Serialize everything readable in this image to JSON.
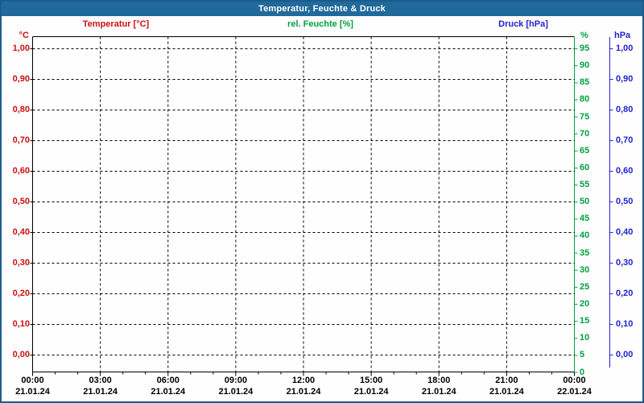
{
  "window": {
    "title": "Temperatur, Feuchte & Druck"
  },
  "colors": {
    "titlebar_bg": "#20699B",
    "frame_border": "#1B5C8D",
    "temperature": "#CC1111",
    "humidity": "#00A040",
    "pressure": "#2222CC",
    "grid": "#000000",
    "background": "#FEFEFE"
  },
  "legend": {
    "temperature": "Temperatur [°C]",
    "humidity": "rel. Feuchte [%]",
    "pressure": "Druck [hPa]"
  },
  "axes": {
    "left": {
      "unit": "°C",
      "color": "#CC1111",
      "ticks": [
        "1,00",
        "0,90",
        "0,80",
        "0,70",
        "0,60",
        "0,50",
        "0,40",
        "0,30",
        "0,20",
        "0,10",
        "0,00"
      ]
    },
    "right_inner": {
      "unit": "%",
      "color": "#00A040",
      "ticks": [
        "95",
        "90",
        "85",
        "80",
        "75",
        "70",
        "65",
        "60",
        "55",
        "50",
        "45",
        "40",
        "35",
        "30",
        "25",
        "20",
        "15",
        "10",
        "5",
        "0"
      ]
    },
    "right_outer": {
      "unit": "hPa",
      "color": "#2222CC",
      "ticks": [
        "1,00",
        "0,90",
        "0,80",
        "0,70",
        "0,60",
        "0,50",
        "0,40",
        "0,30",
        "0,20",
        "0,10",
        "0,00"
      ]
    },
    "bottom": {
      "times": [
        "00:00",
        "03:00",
        "06:00",
        "09:00",
        "12:00",
        "15:00",
        "18:00",
        "21:00",
        "00:00"
      ],
      "dates": [
        "21.01.24",
        "21.01.24",
        "21.01.24",
        "21.01.24",
        "21.01.24",
        "21.01.24",
        "21.01.24",
        "21.01.24",
        "22.01.24"
      ]
    }
  },
  "chart_data": {
    "type": "line",
    "title": "Temperatur, Feuchte & Druck",
    "grid": true,
    "x": {
      "major_tick_hours": 3,
      "minor_tick_hours": 1,
      "range_hours": [
        0,
        24
      ],
      "tick_times": [
        "00:00",
        "03:00",
        "06:00",
        "09:00",
        "12:00",
        "15:00",
        "18:00",
        "21:00",
        "00:00"
      ],
      "tick_dates": [
        "21.01.24",
        "21.01.24",
        "21.01.24",
        "21.01.24",
        "21.01.24",
        "21.01.24",
        "21.01.24",
        "21.01.24",
        "22.01.24"
      ]
    },
    "series": [
      {
        "name": "Temperatur [°C]",
        "unit": "°C",
        "color": "#CC1111",
        "axis": "left",
        "ylim": [
          0.0,
          1.0
        ],
        "tick_step": 0.1,
        "values": []
      },
      {
        "name": "rel. Feuchte [%]",
        "unit": "%",
        "color": "#00A040",
        "axis": "right-inner",
        "ylim": [
          0,
          95
        ],
        "tick_step": 5,
        "values": []
      },
      {
        "name": "Druck [hPa]",
        "unit": "hPa",
        "color": "#2222CC",
        "axis": "right-outer",
        "ylim": [
          0.0,
          1.0
        ],
        "tick_step": 0.1,
        "values": []
      }
    ]
  }
}
